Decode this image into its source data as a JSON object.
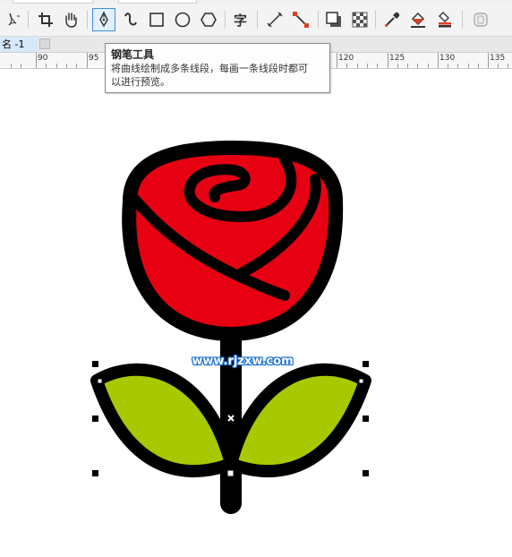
{
  "app": {
    "document_tab": "名 -1"
  },
  "toolbar": {
    "tools": [
      {
        "name": "shape-tool",
        "icon": "shape-node-icon"
      },
      {
        "name": "crop-tool",
        "icon": "crop-icon"
      },
      {
        "name": "pan-tool",
        "icon": "hand-icon"
      },
      {
        "name": "pen-tool",
        "icon": "pen-nib-icon",
        "active": true
      },
      {
        "name": "bspline-tool",
        "icon": "curve-icon"
      },
      {
        "name": "rectangle-tool",
        "icon": "rectangle-icon"
      },
      {
        "name": "ellipse-tool",
        "icon": "ellipse-icon"
      },
      {
        "name": "polygon-tool",
        "icon": "hexagon-icon"
      },
      {
        "name": "text-tool",
        "icon": "text-icon"
      },
      {
        "name": "parallel-dimension-tool",
        "icon": "dimension-icon"
      },
      {
        "name": "connector-tool",
        "icon": "connector-icon"
      },
      {
        "name": "drop-shadow-tool",
        "icon": "shadow-icon"
      },
      {
        "name": "transparency-tool",
        "icon": "transparency-icon"
      },
      {
        "name": "eyedropper-tool",
        "icon": "eyedropper-icon"
      },
      {
        "name": "interactive-fill-tool",
        "icon": "fill-bucket-icon"
      },
      {
        "name": "smart-fill-tool",
        "icon": "smart-fill-icon"
      },
      {
        "name": "lock-toolbar-button",
        "icon": "toolbar-options-icon"
      }
    ]
  },
  "ruler": {
    "labels": [
      "90",
      "95",
      "120",
      "125",
      "130",
      "135"
    ]
  },
  "tooltip": {
    "title": "钢笔工具",
    "line1": "将曲线绘制成多条线段，每画一条线段时都可",
    "line2": "以进行预览。"
  },
  "watermark": {
    "text": "www.rjzxw.com"
  },
  "colors": {
    "rose_red": "#e60012",
    "leaf_green": "#a8c800",
    "outline": "#000000",
    "tooltip_border": "#8a8a8a",
    "active_tool_border": "#3d8ee0",
    "watermark_outline": "#1a6fd0"
  }
}
